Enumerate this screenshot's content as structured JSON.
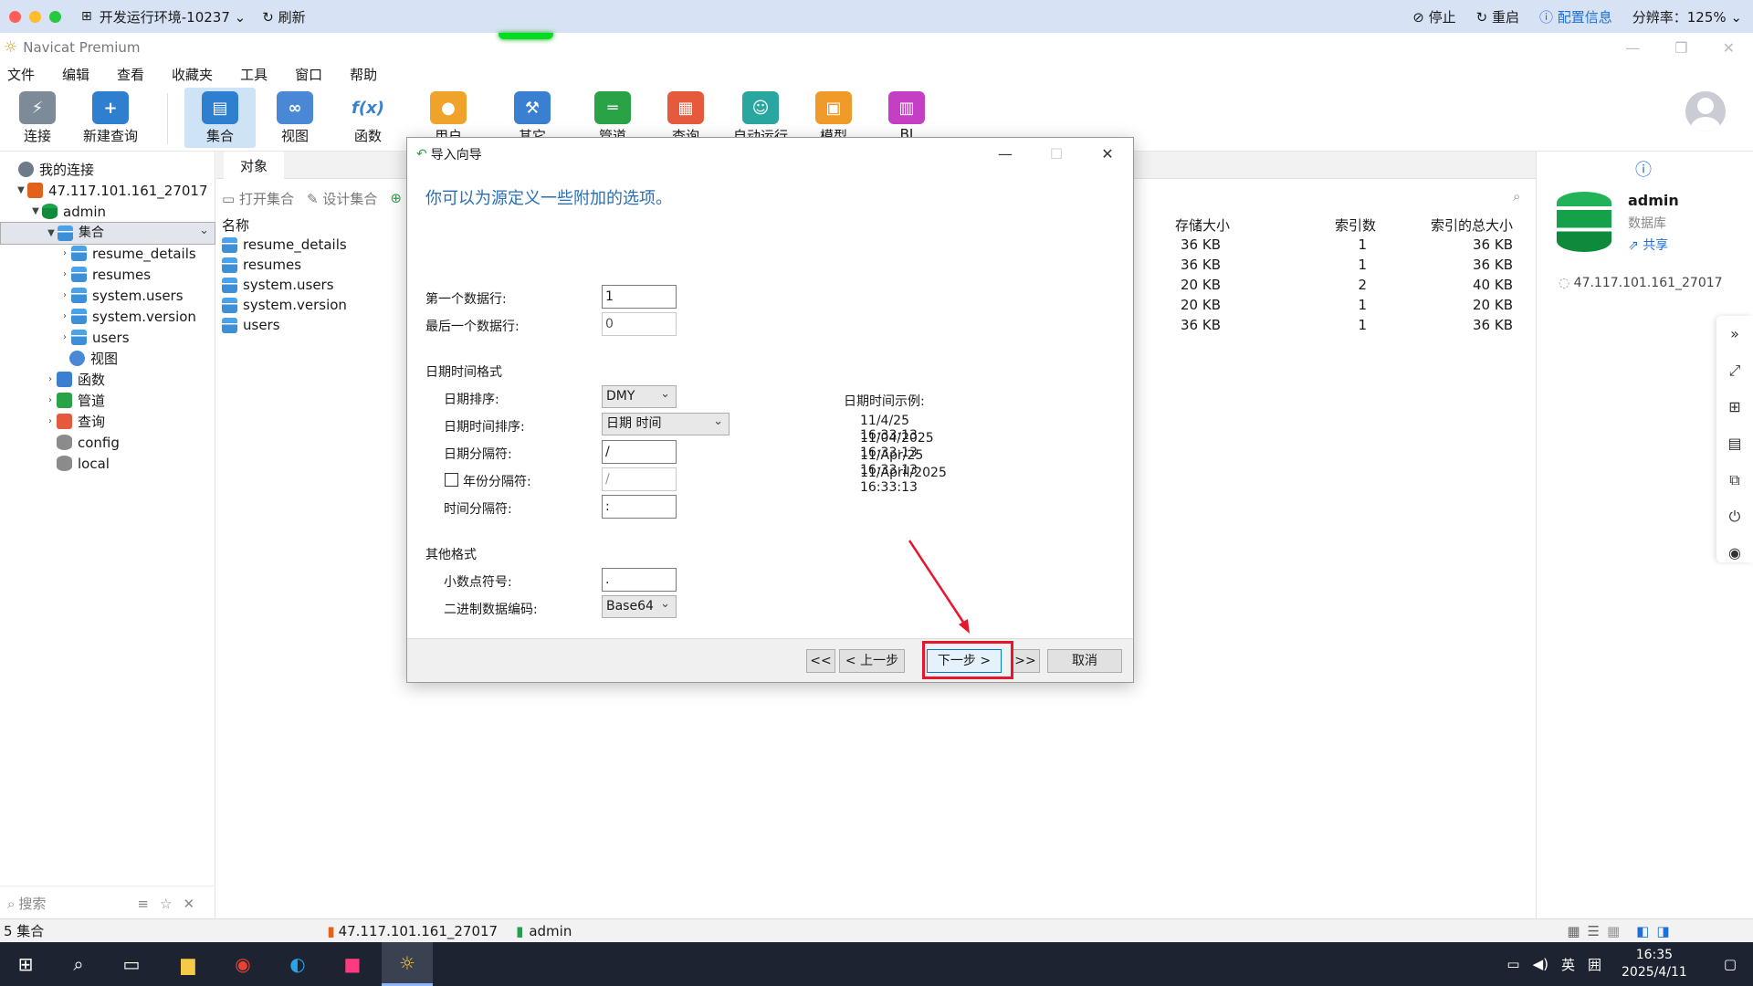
{
  "hostbar": {
    "env": "开发运行环境-10237",
    "refresh": "刷新",
    "stop": "停止",
    "restart": "重启",
    "config": "配置信息",
    "resolution": "分辨率：125%",
    "dot_colors": [
      "#ff5f57",
      "#febc2e",
      "#28c840"
    ]
  },
  "app": {
    "title": "Navicat Premium"
  },
  "menu": [
    "文件",
    "编辑",
    "查看",
    "收藏夹",
    "工具",
    "窗口",
    "帮助"
  ],
  "toolbar": [
    {
      "label": "连接",
      "color": "#7d8b99"
    },
    {
      "label": "新建查询",
      "color": "#2f7fd1"
    },
    {
      "label": "集合",
      "color": "#2f7fd1"
    },
    {
      "label": "视图",
      "color": "#4a88d6"
    },
    {
      "label": "函数",
      "color": "#3a7fd0"
    },
    {
      "label": "用户",
      "color": "#f0a32a"
    },
    {
      "label": "其它",
      "color": "#3a7fd0"
    },
    {
      "label": "管道",
      "color": "#2aa346"
    },
    {
      "label": "查询",
      "color": "#e55a3c"
    },
    {
      "label": "自动运行",
      "color": "#2aa6a0"
    },
    {
      "label": "模型",
      "color": "#f09a2a"
    },
    {
      "label": "BI",
      "color": "#c43fc3"
    }
  ],
  "tree": {
    "root": "我的连接",
    "connection": "47.117.101.161_27017",
    "db": "admin",
    "group": "集合",
    "collections": [
      "resume_details",
      "resumes",
      "system.users",
      "system.version",
      "users"
    ],
    "other": [
      "视图",
      "函数",
      "管道",
      "查询"
    ],
    "dbs": [
      "config",
      "local"
    ],
    "search_placeholder": "搜索"
  },
  "main": {
    "tab": "对象",
    "open": "打开集合",
    "design": "设计集合",
    "columns": {
      "name": "名称",
      "storage": "存储大小",
      "indexes": "索引数",
      "index_size": "索引的总大小"
    },
    "rows": [
      {
        "name": "resume_details",
        "storage": "36 KB",
        "indexes": "1",
        "index_size": "36 KB"
      },
      {
        "name": "resumes",
        "storage": "36 KB",
        "indexes": "1",
        "index_size": "36 KB"
      },
      {
        "name": "system.users",
        "storage": "20 KB",
        "indexes": "2",
        "index_size": "40 KB"
      },
      {
        "name": "system.version",
        "storage": "20 KB",
        "indexes": "1",
        "index_size": "20 KB"
      },
      {
        "name": "users",
        "storage": "36 KB",
        "indexes": "1",
        "index_size": "36 KB"
      }
    ]
  },
  "rpanel": {
    "name": "admin",
    "type": "数据库",
    "share": "共享",
    "conn": "47.117.101.161_27017"
  },
  "status": {
    "count": "5 集合",
    "conn": "47.117.101.161_27017",
    "db": "admin"
  },
  "taskbar": {
    "time": "16:35",
    "date": "2025/4/11",
    "ime": "英"
  },
  "dialog": {
    "title": "导入向导",
    "heading": "你可以为源定义一些附加的选项。",
    "first_row_label": "第一个数据行:",
    "first_row": "1",
    "last_row_label": "最后一个数据行:",
    "last_row": "0",
    "dt_section": "日期时间格式",
    "date_order_label": "日期排序:",
    "date_order": "DMY",
    "dt_order_label": "日期时间排序:",
    "dt_order": "日期 时间",
    "date_sep_label": "日期分隔符:",
    "date_sep": "/",
    "year_sep_label": "年份分隔符:",
    "year_sep": "/",
    "time_sep_label": "时间分隔符:",
    "time_sep": ":",
    "example_label": "日期时间示例:",
    "examples": [
      "11/4/25 16:33:13",
      "11/04/2025 16:33:13",
      "11/Apr/25 16:33:13",
      "11/April/2025 16:33:13"
    ],
    "other_section": "其他格式",
    "decimal_label": "小数点符号:",
    "decimal": ".",
    "binary_label": "二进制数据编码:",
    "binary": "Base64",
    "btn_first": "<<",
    "btn_prev": "< 上一步",
    "btn_next": "下一步 >",
    "btn_last": ">>",
    "btn_cancel": "取消"
  }
}
